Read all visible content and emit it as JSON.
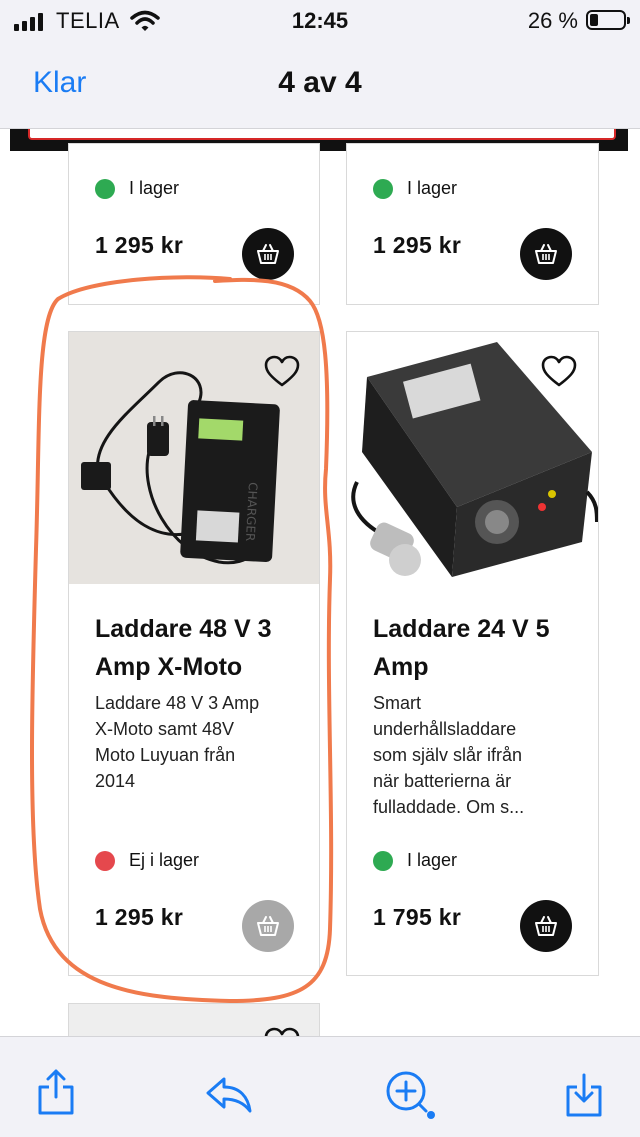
{
  "status_bar": {
    "carrier": "TELIA",
    "time": "12:45",
    "battery": "26 %",
    "battery_level": 0.26
  },
  "nav": {
    "done_label": "Klar",
    "title": "4 av 4"
  },
  "products_top": [
    {
      "stock": "I lager",
      "stock_color": "#2eaa52",
      "price": "1 295 kr"
    },
    {
      "stock": "I lager",
      "stock_color": "#2eaa52",
      "price": "1 295 kr"
    }
  ],
  "products": [
    {
      "name_line1": "Laddare 48 V 3",
      "name_line2": "Amp X-Moto",
      "desc": [
        "Laddare 48 V 3 Amp",
        "X-Moto samt 48V",
        "Moto Luyuan från",
        "2014"
      ],
      "stock": "Ej i lager",
      "stock_color": "#e5484d",
      "price": "1 295 kr",
      "cart_enabled": false
    },
    {
      "name_line1": "Laddare 24 V 5",
      "name_line2": "Amp",
      "desc": [
        "Smart",
        "underhållsladdare",
        "som själv slår ifrån",
        "när batterierna är",
        "fulladdade. Om s..."
      ],
      "stock": "I lager",
      "stock_color": "#2eaa52",
      "price": "1 795 kr",
      "cart_enabled": true
    }
  ],
  "colors": {
    "accent": "#1a7cf4",
    "annotation": "#f07a4c",
    "in_stock": "#2eaa52",
    "out_of_stock": "#e5484d"
  },
  "toolbar": {
    "icons": [
      "share-icon",
      "reply-icon",
      "markup-zoom-icon",
      "save-icon"
    ]
  }
}
